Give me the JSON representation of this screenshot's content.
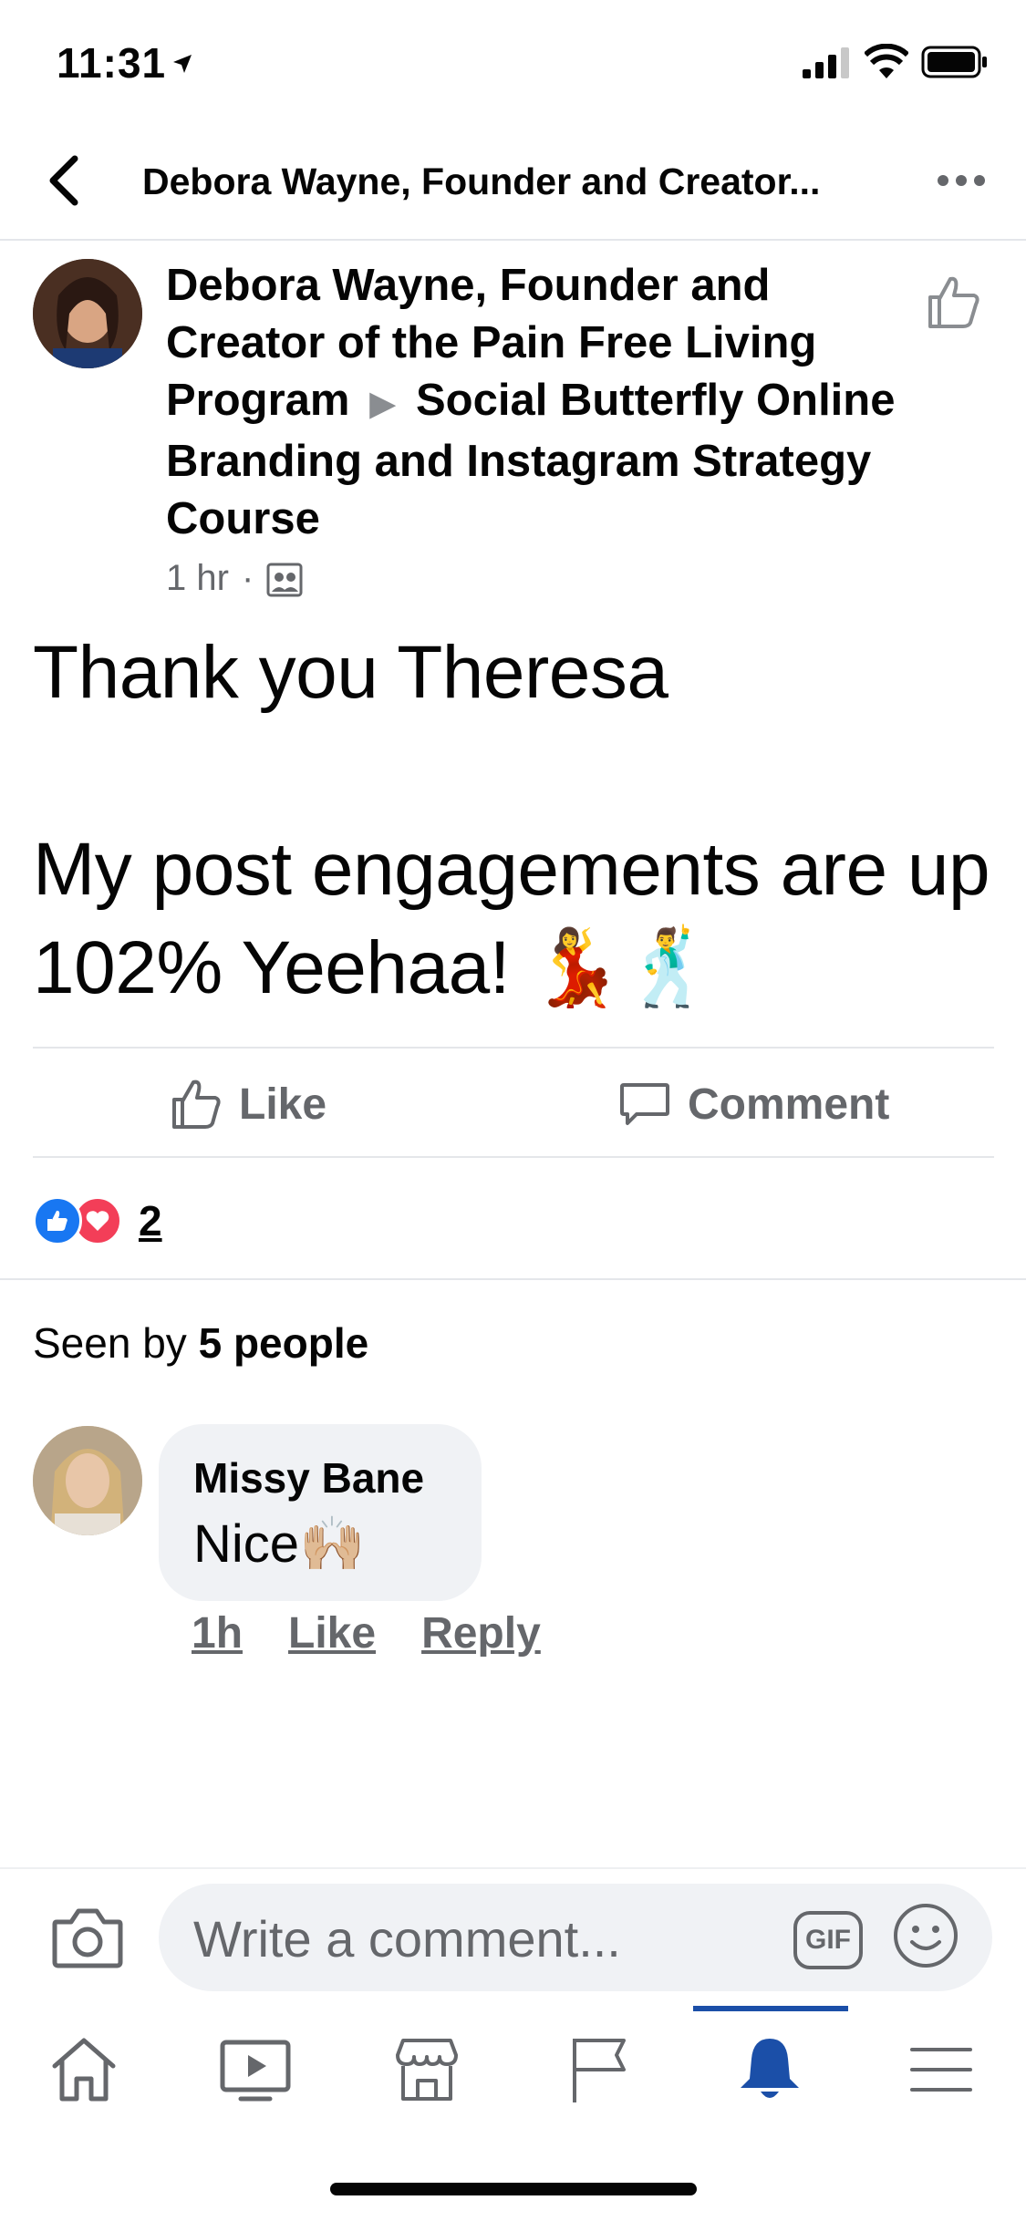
{
  "status_bar": {
    "time": "11:31"
  },
  "nav": {
    "title": "Debora Wayne, Founder and Creator..."
  },
  "post": {
    "author": "Debora Wayne, Founder and Creator of the Pain Free Living Program",
    "arrow": "▶",
    "group": "Social Butterfly Online Branding and Instagram Strategy Course",
    "time": "1 hr",
    "separator": "·",
    "text_line1": "Thank you Theresa",
    "text_line2": "My post engagements are up 102% Yeehaa! 💃🕺"
  },
  "actions": {
    "like": "Like",
    "comment": "Comment"
  },
  "reactions": {
    "count": "2"
  },
  "seen": {
    "prefix": "Seen by",
    "count_text": "5 people"
  },
  "comment": {
    "name": "Missy Bane",
    "text": "Nice🙌🏼",
    "time": "1h",
    "like": "Like",
    "reply": "Reply"
  },
  "composer": {
    "placeholder": "Write a comment...",
    "gif": "GIF"
  },
  "tabs": [
    "home-icon",
    "watch-icon",
    "marketplace-icon",
    "pages-flag-icon",
    "notifications-bell-icon",
    "menu-icon"
  ],
  "colors": {
    "accent": "#1b4fa8",
    "like_blue": "#1877f2",
    "love_red": "#f33e58",
    "secondary_text": "#65676b"
  }
}
